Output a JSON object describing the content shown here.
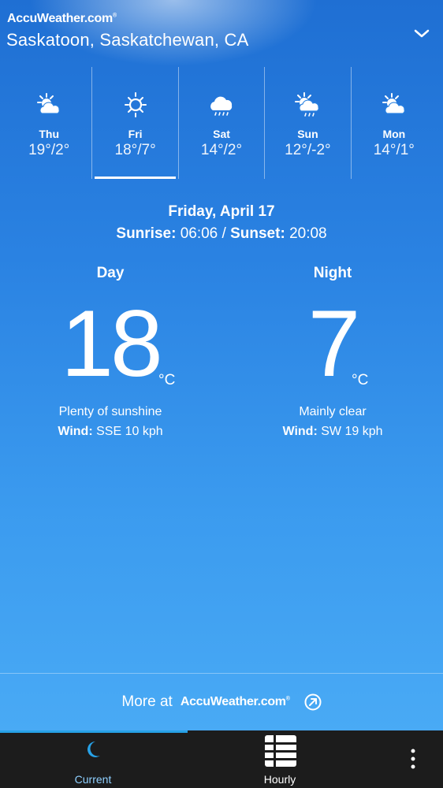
{
  "header": {
    "brand": "AccuWeather.com",
    "brand_mark": "®",
    "location": "Saskatoon, Saskatchewan, CA",
    "location_menu_icon": "chevron-down-icon"
  },
  "forecast_days": [
    {
      "name": "Thu",
      "temps": "19°/2°",
      "icon": "partly-sunny-icon",
      "selected": false
    },
    {
      "name": "Fri",
      "temps": "18°/7°",
      "icon": "sunny-icon",
      "selected": true
    },
    {
      "name": "Sat",
      "temps": "14°/2°",
      "icon": "rain-cloud-icon",
      "selected": false
    },
    {
      "name": "Sun",
      "temps": "12°/-2°",
      "icon": "sun-cloud-rain-icon",
      "selected": false
    },
    {
      "name": "Mon",
      "temps": "14°/1°",
      "icon": "partly-sunny-icon",
      "selected": false
    }
  ],
  "detail": {
    "date": "Friday, April 17",
    "sunrise_label": "Sunrise:",
    "sunrise": "06:06",
    "separator": "/",
    "sunset_label": "Sunset:",
    "sunset": "20:08",
    "day": {
      "heading": "Day",
      "temp": "18",
      "unit": "°C",
      "condition": "Plenty of sunshine",
      "wind_label": "Wind:",
      "wind": "SSE 10 kph"
    },
    "night": {
      "heading": "Night",
      "temp": "7",
      "unit": "°C",
      "condition": "Mainly clear",
      "wind_label": "Wind:",
      "wind": "SW 19 kph"
    }
  },
  "more": {
    "label": "More at",
    "brand": "AccuWeather.com",
    "brand_mark": "®"
  },
  "nav": {
    "current": "Current",
    "hourly": "Hourly",
    "active_color": "#27a1e6"
  }
}
